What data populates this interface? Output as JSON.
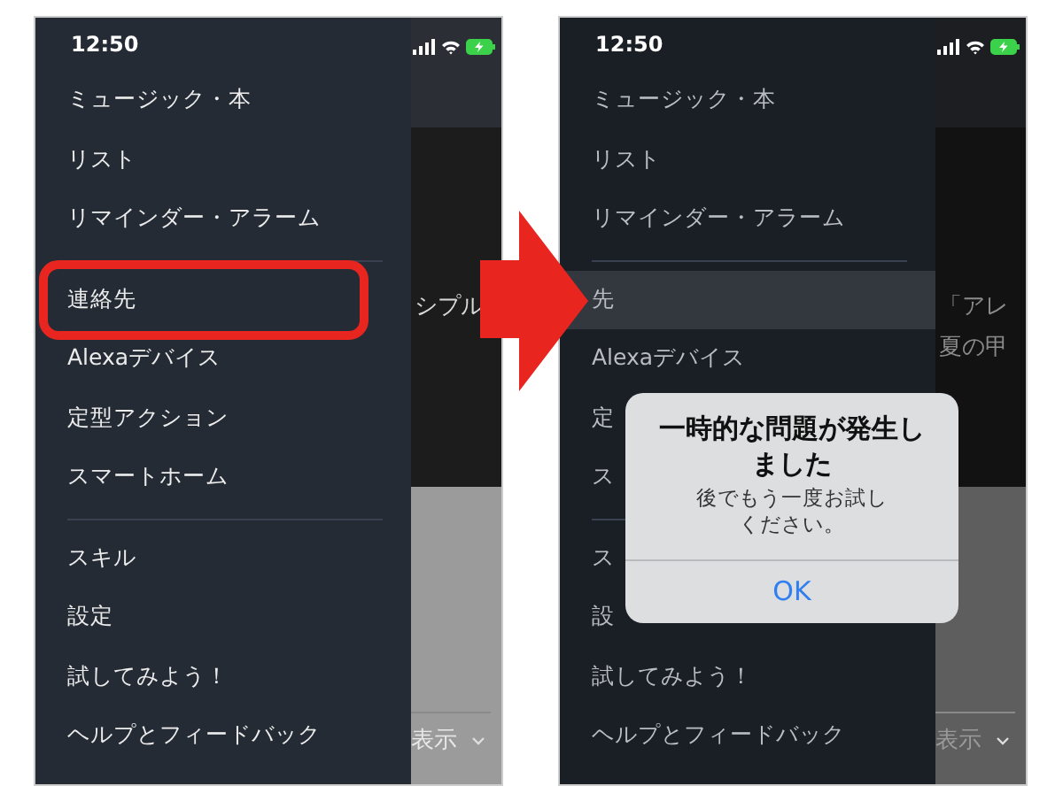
{
  "panels": [
    {
      "status_bar": {
        "time": "12:50"
      },
      "menu_sections": [
        [
          {
            "label": "ミュージック・本",
            "selected": false,
            "highlighted": false
          },
          {
            "label": "リスト",
            "selected": false,
            "highlighted": false
          },
          {
            "label": "リマインダー・アラーム",
            "selected": false,
            "highlighted": false
          }
        ],
        [
          {
            "label": "連絡先",
            "selected": false,
            "highlighted": true
          },
          {
            "label": "Alexaデバイス",
            "selected": false,
            "highlighted": false
          },
          {
            "label": "定型アクション",
            "selected": false,
            "highlighted": false
          },
          {
            "label": "スマートホーム",
            "selected": false,
            "highlighted": false
          }
        ],
        [
          {
            "label": "スキル",
            "selected": false,
            "highlighted": false
          },
          {
            "label": "設定",
            "selected": false,
            "highlighted": false
          },
          {
            "label": "試してみよう！",
            "selected": false,
            "highlighted": false
          },
          {
            "label": "ヘルプとフィードバック",
            "selected": false,
            "highlighted": false
          }
        ]
      ],
      "background_texts": [
        "シプル"
      ],
      "footer_text": "表示"
    },
    {
      "status_bar": {
        "time": "12:50"
      },
      "menu_sections": [
        [
          {
            "label": "ミュージック・本",
            "selected": false,
            "highlighted": false
          },
          {
            "label": "リスト",
            "selected": false,
            "highlighted": false
          },
          {
            "label": "リマインダー・アラーム",
            "selected": false,
            "highlighted": false
          }
        ],
        [
          {
            "label": "先",
            "selected": true,
            "highlighted": false
          },
          {
            "label": "Alexaデバイス",
            "selected": false,
            "highlighted": false
          },
          {
            "label": "定",
            "selected": false,
            "highlighted": false
          },
          {
            "label": "ス",
            "selected": false,
            "highlighted": false
          }
        ],
        [
          {
            "label": "ス",
            "selected": false,
            "highlighted": false
          },
          {
            "label": "設",
            "selected": false,
            "highlighted": false
          },
          {
            "label": "試してみよう！",
            "selected": false,
            "highlighted": false
          },
          {
            "label": "ヘルプとフィードバック",
            "selected": false,
            "highlighted": false
          }
        ]
      ],
      "background_texts": [
        "「アレ",
        "夏の甲"
      ],
      "footer_text": "表示",
      "dialog": {
        "title": "一時的な問題が発生しました",
        "message": "後でもう一度お試しください。",
        "button": "OK"
      }
    }
  ]
}
